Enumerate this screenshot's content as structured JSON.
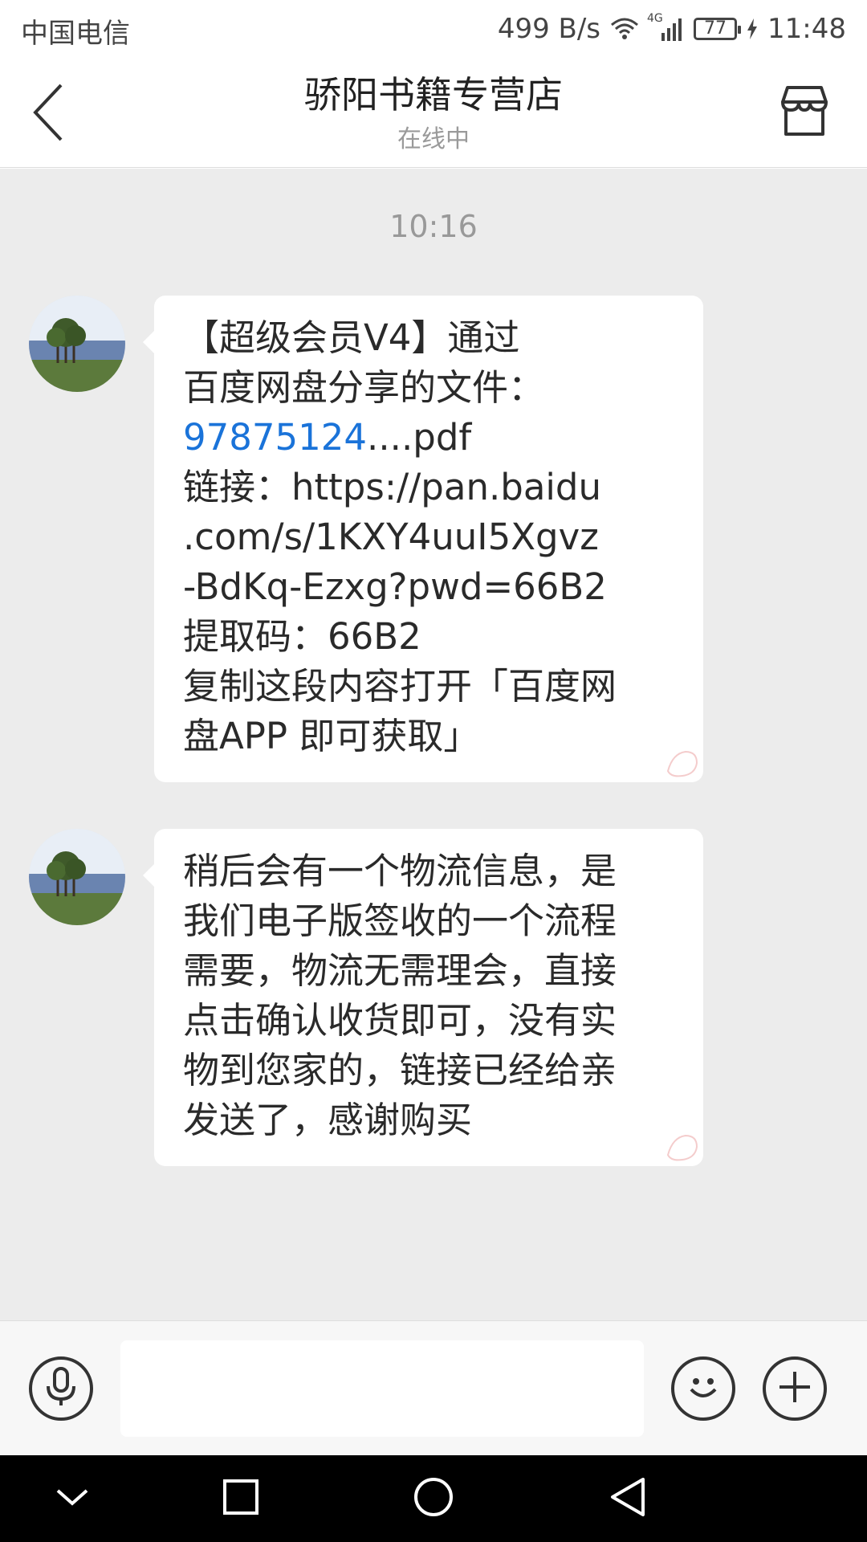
{
  "status_bar": {
    "carrier": "中国电信",
    "net_speed": "499 B/s",
    "network_type": "4G",
    "battery": "77",
    "time": "11:48",
    "icons": [
      "wifi-icon",
      "signal-icon",
      "battery-icon",
      "charging-icon"
    ]
  },
  "header": {
    "title": "骄阳书籍专营店",
    "status": "在线中",
    "back_icon": "chevron-left-icon",
    "store_icon": "store-icon"
  },
  "chat": {
    "timestamp": "10:16",
    "messages": [
      {
        "sender": "shop",
        "lines": [
          "【超级会员V4】通过",
          "百度网盘分享的文件：",
          {
            "link": "97875124",
            "rest": "....pdf"
          },
          "链接：https://pan.baidu",
          ".com/s/1KXY4uuI5Xgvz",
          "-BdKq-Ezxg?pwd=66B2",
          "提取码：66B2",
          "复制这段内容打开「百度网",
          "盘APP 即可获取」"
        ]
      },
      {
        "sender": "shop",
        "lines": [
          "稍后会有一个物流信息，是",
          "我们电子版签收的一个流程",
          "需要，物流无需理会，直接",
          "点击确认收货即可，没有实",
          "物到您家的，链接已经给亲",
          "发送了，感谢购买"
        ]
      }
    ]
  },
  "input_bar": {
    "placeholder": "",
    "icons": [
      "microphone-icon",
      "emoji-icon",
      "plus-icon"
    ]
  },
  "nav_bar": {
    "icons": [
      "collapse-icon",
      "recent-apps-icon",
      "home-icon",
      "back-triangle-icon"
    ]
  },
  "colors": {
    "chat_background": "#ececec",
    "bubble": "#ffffff",
    "link": "#1a73d9",
    "nav_bar": "#000000"
  }
}
